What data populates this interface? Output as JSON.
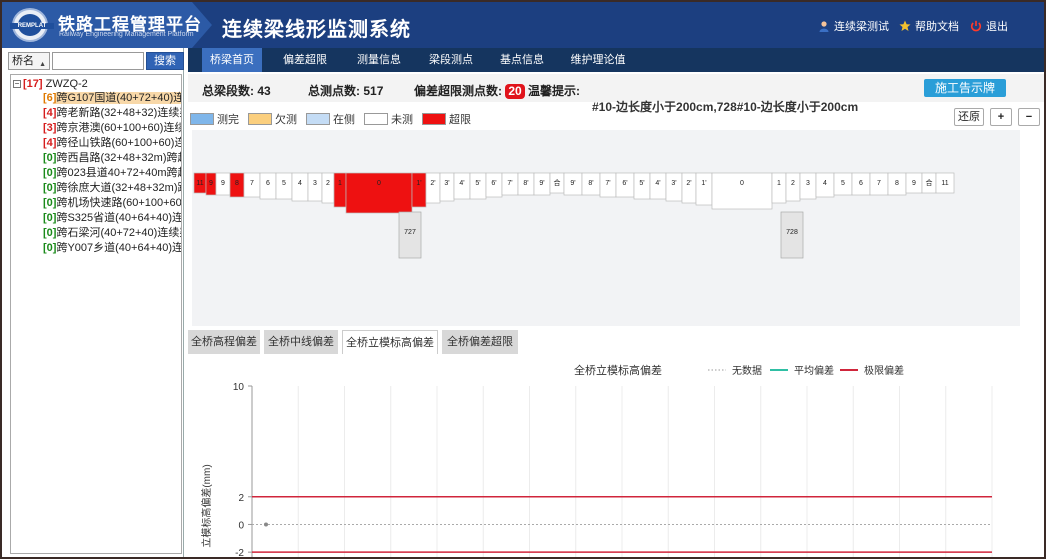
{
  "header": {
    "logo_text": "REMPLAT",
    "platform_title": "铁路工程管理平台",
    "platform_subtitle": "Railway Engineering Management Platform",
    "system_title": "连续梁线形监测系统",
    "links": [
      {
        "label": "连续梁测试",
        "icon": "user-icon"
      },
      {
        "label": "帮助文档",
        "icon": "star-icon"
      },
      {
        "label": "退出",
        "icon": "power-icon"
      }
    ]
  },
  "search": {
    "select_value": "桥名",
    "input_value": "",
    "button_label": "搜索"
  },
  "tree": {
    "root": {
      "count": "[17]",
      "name": "ZWZQ-2"
    },
    "items": [
      {
        "count": "[6]",
        "name": "跨G107国道(40+72+40)连",
        "color": "#e07a00",
        "selected": true
      },
      {
        "count": "[4]",
        "name": "跨老新路(32+48+32)连续梁",
        "color": "#d61d1d",
        "selected": false
      },
      {
        "count": "[3]",
        "name": "跨京港澳(60+100+60)连续",
        "color": "#d61d1d",
        "selected": false
      },
      {
        "count": "[4]",
        "name": "跨径山铁路(60+100+60)连",
        "color": "#d61d1d",
        "selected": false
      },
      {
        "count": "[0]",
        "name": "跨西昌路(32+48+32m)跨越",
        "color": "#1a8a1a",
        "selected": false
      },
      {
        "count": "[0]",
        "name": "跨023县道40+72+40m跨越",
        "color": "#1a8a1a",
        "selected": false
      },
      {
        "count": "[0]",
        "name": "跨徐庶大道(32+48+32m)跨",
        "color": "#1a8a1a",
        "selected": false
      },
      {
        "count": "[0]",
        "name": "跨机场快速路(60+100+60)",
        "color": "#1a8a1a",
        "selected": false
      },
      {
        "count": "[0]",
        "name": "跨S325省道(40+64+40)连续",
        "color": "#1a8a1a",
        "selected": false
      },
      {
        "count": "[0]",
        "name": "跨石梁河(40+72+40)连续梁",
        "color": "#1a8a1a",
        "selected": false
      },
      {
        "count": "[0]",
        "name": "跨Y007乡道(40+64+40)连续",
        "color": "#1a8a1a",
        "selected": false
      }
    ]
  },
  "nav": {
    "tabs": [
      {
        "label": "桥梁首页",
        "active": true
      },
      {
        "label": "偏差超限",
        "active": false
      },
      {
        "label": "测量信息",
        "active": false
      },
      {
        "label": "梁段测点",
        "active": false
      },
      {
        "label": "基点信息",
        "active": false
      },
      {
        "label": "维护理论值",
        "active": false
      }
    ]
  },
  "stats": {
    "segments_label": "总梁段数:",
    "segments_value": "43",
    "points_label": "总测点数:",
    "points_value": "517",
    "overflow_label": "偏差超限测点数:",
    "overflow_value": "20",
    "tip_label": "温馨提示:",
    "tip_text": "#10-边长度小于200cm,728#10-边长度小于200cm",
    "notice_button": "施工告示牌"
  },
  "legend": [
    {
      "label": "测完",
      "color": "#7fb6ea"
    },
    {
      "label": "欠测",
      "color": "#fbcf7e"
    },
    {
      "label": "在侧",
      "color": "#c4dcf5"
    },
    {
      "label": "未测",
      "color": "#ffffff"
    },
    {
      "label": "超限",
      "color": "#ee1111"
    }
  ],
  "tools": {
    "restore": "还原",
    "zoom_in": "+",
    "zoom_out": "−"
  },
  "colors": {
    "header_bg": "#1c3f80",
    "nav_bg": "#15355f",
    "accent": "#2f63b5",
    "over_limit": "#ee1111"
  },
  "diagram": {
    "left_segments": [
      {
        "label": "11",
        "over": true
      },
      {
        "label": "9",
        "over": true
      },
      {
        "label": "9",
        "over": false
      },
      {
        "label": "8",
        "over": true
      },
      {
        "label": "7",
        "over": false
      },
      {
        "label": "6",
        "over": false
      },
      {
        "label": "5",
        "over": false
      },
      {
        "label": "4",
        "over": false
      },
      {
        "label": "3",
        "over": false
      },
      {
        "label": "2",
        "over": false
      },
      {
        "label": "1",
        "over": true
      },
      {
        "label": "0",
        "over": true
      },
      {
        "label": "1'",
        "over": true
      },
      {
        "label": "2'",
        "over": false
      },
      {
        "label": "3'",
        "over": false
      },
      {
        "label": "4'",
        "over": false
      },
      {
        "label": "5'",
        "over": false
      },
      {
        "label": "6'",
        "over": false
      },
      {
        "label": "7'",
        "over": false
      },
      {
        "label": "8'",
        "over": false
      },
      {
        "label": "9'",
        "over": false
      },
      {
        "label": "合",
        "over": false
      }
    ],
    "right_segments": [
      {
        "label": "9'",
        "over": false
      },
      {
        "label": "8'",
        "over": false
      },
      {
        "label": "7'",
        "over": false
      },
      {
        "label": "6'",
        "over": false
      },
      {
        "label": "5'",
        "over": false
      },
      {
        "label": "4'",
        "over": false
      },
      {
        "label": "3'",
        "over": false
      },
      {
        "label": "2'",
        "over": false
      },
      {
        "label": "1'",
        "over": false
      },
      {
        "label": "0",
        "over": false
      },
      {
        "label": "1",
        "over": false
      },
      {
        "label": "2",
        "over": false
      },
      {
        "label": "3",
        "over": false
      },
      {
        "label": "4",
        "over": false
      },
      {
        "label": "5",
        "over": false
      },
      {
        "label": "6",
        "over": false
      },
      {
        "label": "7",
        "over": false
      },
      {
        "label": "8",
        "over": false
      },
      {
        "label": "9",
        "over": false
      },
      {
        "label": "合",
        "over": false
      },
      {
        "label": "11",
        "over": false
      }
    ],
    "piers": [
      "727",
      "728"
    ]
  },
  "lower_tabs": [
    {
      "label": "全桥高程偏差",
      "active": false
    },
    {
      "label": "全桥中线偏差",
      "active": false
    },
    {
      "label": "全桥立模标高偏差",
      "active": true
    },
    {
      "label": "全桥偏差超限",
      "active": false
    }
  ],
  "chart_data": {
    "type": "line",
    "title": "全桥立模标高偏差",
    "ylabel": "立模标高偏差(mm)",
    "xlabel": "",
    "ylim": [
      -3,
      10
    ],
    "yticks": [
      10,
      2,
      0,
      -2
    ],
    "legend_position": "top-right",
    "grid": true,
    "series": [
      {
        "name": "无数据",
        "color": "#999999",
        "style": "dotted",
        "points": [
          [
            0,
            0
          ]
        ]
      },
      {
        "name": "平均偏差",
        "color": "#2fbfa4",
        "style": "solid",
        "points": []
      },
      {
        "name": "极限偏差",
        "color": "#d0253b",
        "style": "solid",
        "limits": [
          2,
          -2
        ]
      }
    ]
  }
}
